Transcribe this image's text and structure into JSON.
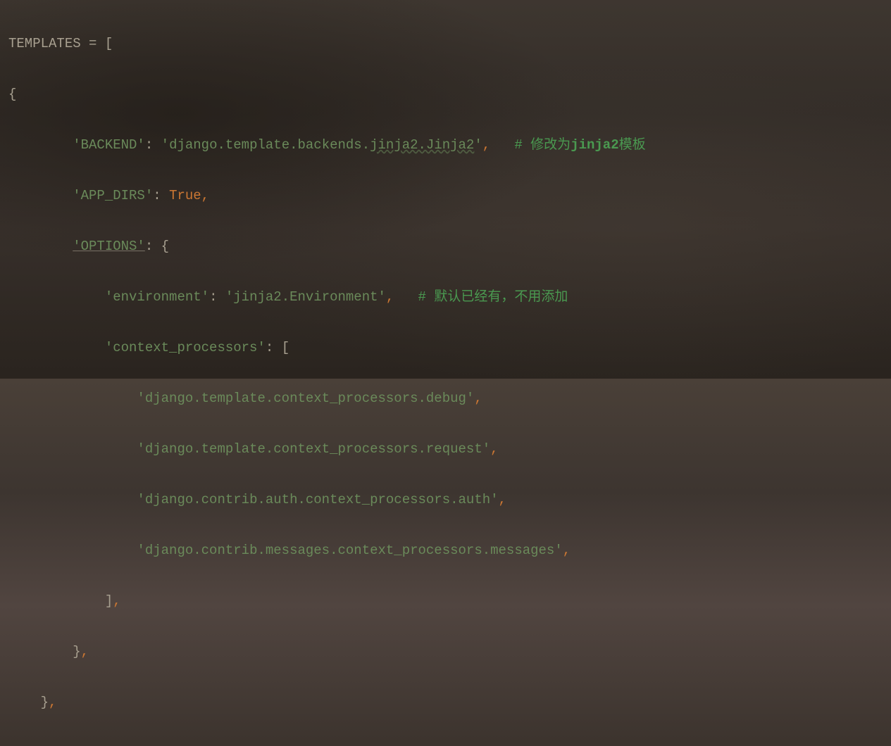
{
  "code": {
    "line1": {
      "var": "TEMPLATES",
      "eq": " = ",
      "bracket": "["
    },
    "line2": "{",
    "line3": {
      "indent": "        ",
      "key": "'BACKEND'",
      "colon": ": ",
      "value_part1": "'",
      "value_part2": "django.template.backends.",
      "value_part3": "jinja2.Jinja2",
      "value_part4": "'",
      "comma": ",",
      "spaces": "   ",
      "comment_hash": "# 修改为",
      "comment_bold": "jinja2",
      "comment_rest": "模板"
    },
    "line4": {
      "indent": "        ",
      "key": "'APP_DIRS'",
      "colon": ": ",
      "value": "True",
      "comma": ","
    },
    "line5": {
      "indent": "        ",
      "key": "'OPTIONS'",
      "colon": ": ",
      "brace": "{"
    },
    "line6": {
      "indent": "            ",
      "key": "'environment'",
      "colon": ": ",
      "value": "'jinja2.Environment'",
      "comma": ",",
      "spaces": "   ",
      "comment": "# 默认已经有，不用添加"
    },
    "line7": {
      "indent": "            ",
      "key": "'context_processors'",
      "colon": ": ",
      "bracket": "["
    },
    "line8": {
      "indent": "                ",
      "value": "'django.template.context_processors.debug'",
      "comma": ","
    },
    "line9": {
      "indent": "                ",
      "value": "'django.template.context_processors.request'",
      "comma": ","
    },
    "line10": {
      "indent": "                ",
      "value": "'django.contrib.auth.context_processors.auth'",
      "comma": ","
    },
    "line11": {
      "indent": "                ",
      "value": "'django.contrib.messages.context_processors.messages'",
      "comma": ","
    },
    "line12": {
      "indent": "            ",
      "bracket": "]",
      "comma": ","
    },
    "line13": {
      "indent": "        ",
      "brace": "}",
      "comma": ","
    },
    "line14": {
      "indent": "    ",
      "brace": "}",
      "comma": ","
    }
  }
}
